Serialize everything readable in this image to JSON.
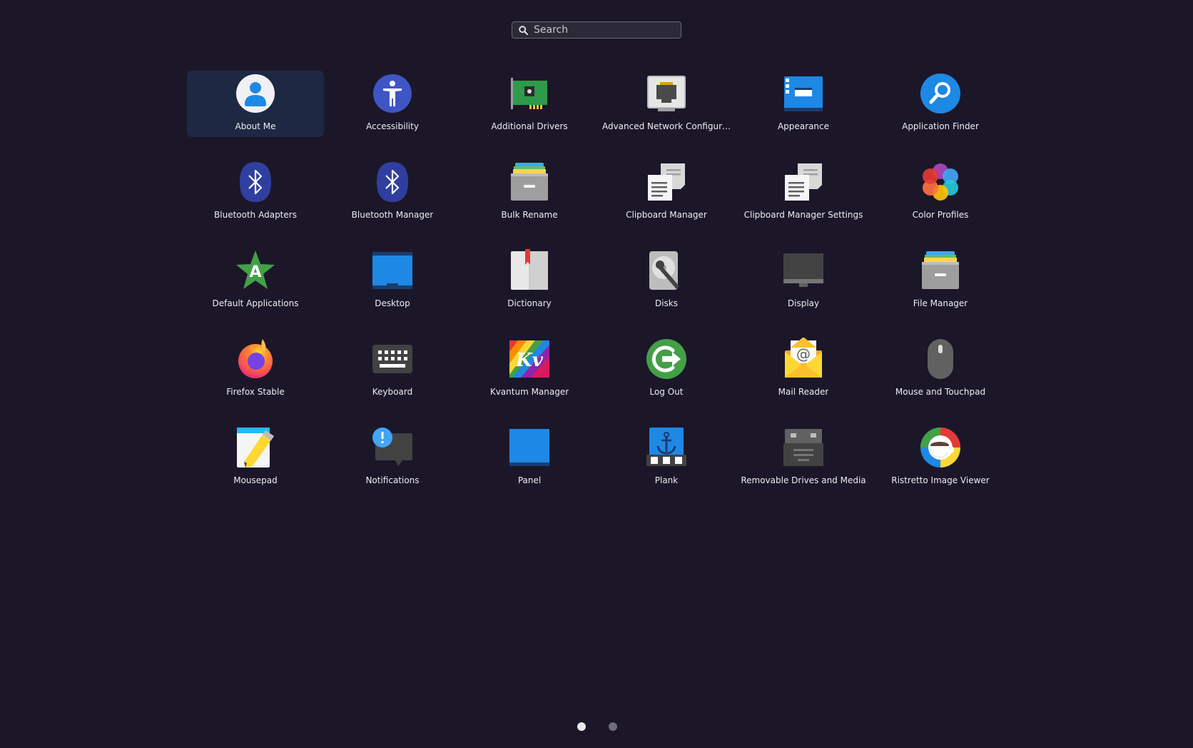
{
  "search": {
    "placeholder": "Search"
  },
  "apps": [
    {
      "label": "About Me",
      "icon": "user-icon",
      "selected": true
    },
    {
      "label": "Accessibility",
      "icon": "accessibility-icon"
    },
    {
      "label": "Additional Drivers",
      "icon": "hardware-card-icon"
    },
    {
      "label": "Advanced Network Configur…",
      "icon": "network-port-icon"
    },
    {
      "label": "Appearance",
      "icon": "appearance-window-icon"
    },
    {
      "label": "Application Finder",
      "icon": "magnifier-icon"
    },
    {
      "label": "Bluetooth Adapters",
      "icon": "bluetooth-icon"
    },
    {
      "label": "Bluetooth Manager",
      "icon": "bluetooth-icon"
    },
    {
      "label": "Bulk Rename",
      "icon": "file-cabinet-icon"
    },
    {
      "label": "Clipboard Manager",
      "icon": "clipboard-documents-icon"
    },
    {
      "label": "Clipboard Manager Settings",
      "icon": "clipboard-documents-icon"
    },
    {
      "label": "Color Profiles",
      "icon": "color-petals-icon"
    },
    {
      "label": "Default Applications",
      "icon": "star-a-icon"
    },
    {
      "label": "Desktop",
      "icon": "desktop-screen-icon"
    },
    {
      "label": "Dictionary",
      "icon": "book-icon"
    },
    {
      "label": "Disks",
      "icon": "disk-wrench-icon"
    },
    {
      "label": "Display",
      "icon": "monitor-icon"
    },
    {
      "label": "File Manager",
      "icon": "file-cabinet-icon"
    },
    {
      "label": "Firefox Stable",
      "icon": "firefox-icon"
    },
    {
      "label": "Keyboard",
      "icon": "keyboard-icon"
    },
    {
      "label": "Kvantum Manager",
      "icon": "kvantum-icon"
    },
    {
      "label": "Log Out",
      "icon": "logout-icon"
    },
    {
      "label": "Mail Reader",
      "icon": "mail-envelope-icon"
    },
    {
      "label": "Mouse and Touchpad",
      "icon": "mouse-icon"
    },
    {
      "label": "Mousepad",
      "icon": "notepad-pencil-icon"
    },
    {
      "label": "Notifications",
      "icon": "notification-bubble-icon"
    },
    {
      "label": "Panel",
      "icon": "panel-icon"
    },
    {
      "label": "Plank",
      "icon": "anchor-dock-icon"
    },
    {
      "label": "Removable Drives and Media",
      "icon": "removable-drive-icon"
    },
    {
      "label": "Ristretto Image Viewer",
      "icon": "coffee-cup-icon"
    }
  ],
  "pager": {
    "pages": 2,
    "current": 1
  }
}
